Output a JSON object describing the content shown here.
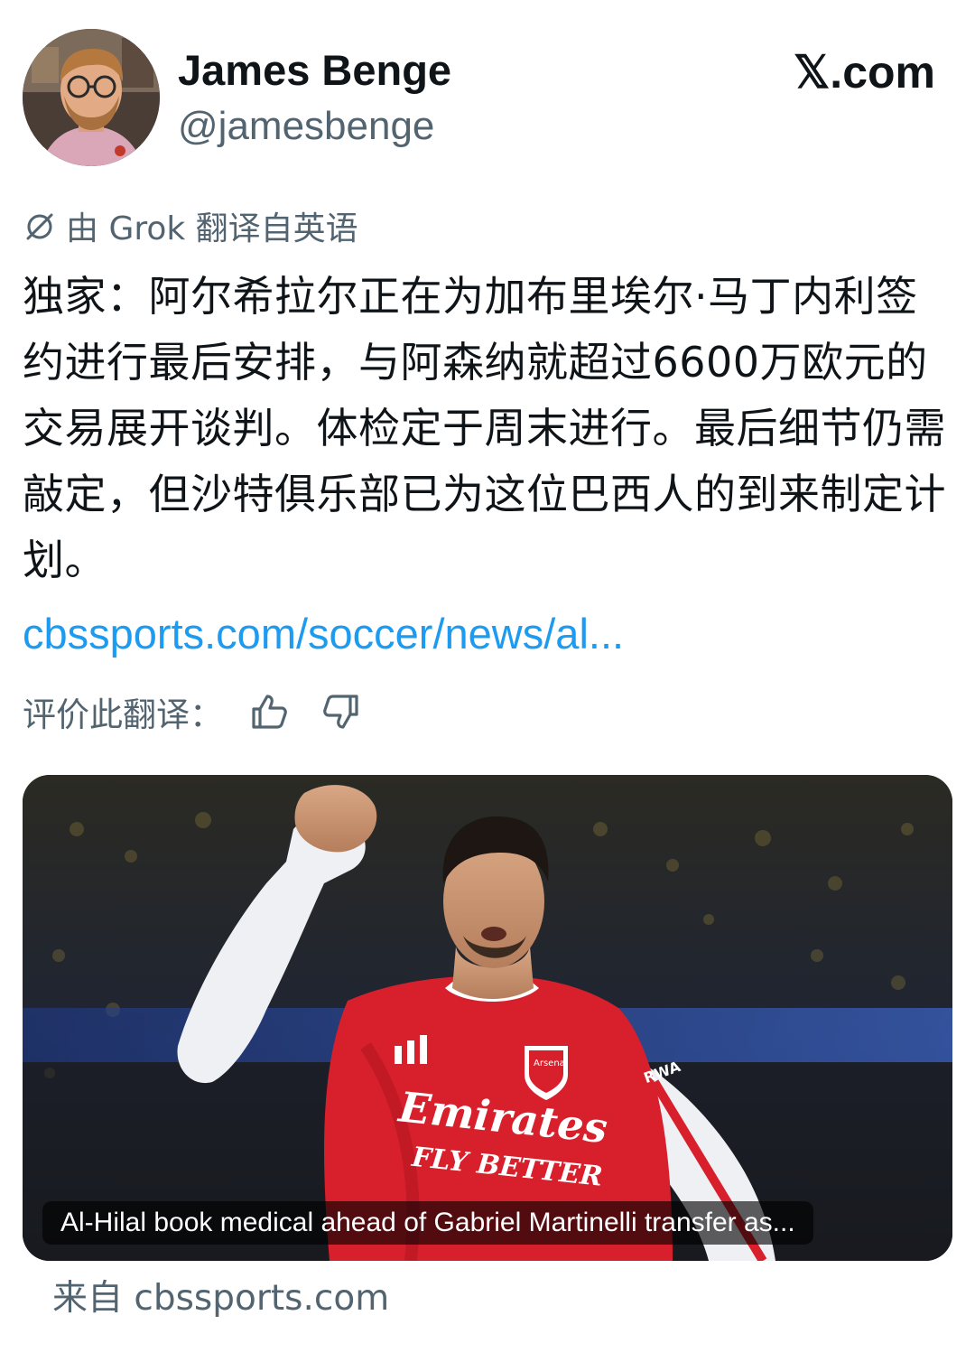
{
  "author": {
    "display_name": "James Benge",
    "handle": "@jamesbenge",
    "avatar_icon": "profile-photo"
  },
  "watermark": "𝕏.com",
  "translation": {
    "icon": "translate-slash-icon",
    "note": "由 Grok 翻译自英语",
    "rate_label": "评价此翻译：",
    "thumbs_up_icon": "thumbs-up-icon",
    "thumbs_down_icon": "thumbs-down-icon"
  },
  "tweet": {
    "text": "独家：阿尔希拉尔正在为加布里埃尔·马丁内利签约进行最后安排，与阿森纳就超过6600万欧元的交易展开谈判。体检定于周末进行。最后细节仍需敲定，但沙特俱乐部已为这位巴西人的到来制定计划。",
    "link": "cbssports.com/soccer/news/al..."
  },
  "card": {
    "caption": "Al-Hilal book medical ahead of Gabriel Martinelli transfer as...",
    "source": "来自 cbssports.com",
    "shirt_sponsor_line1": "Emirates",
    "shirt_sponsor_line2": "FLY BETTER",
    "crest_text": "Arsenal",
    "sleeve_text": "RWA"
  },
  "colors": {
    "text_primary": "#0f1419",
    "text_secondary": "#536471",
    "link": "#1d9bf0",
    "kit_red": "#d8202c"
  }
}
